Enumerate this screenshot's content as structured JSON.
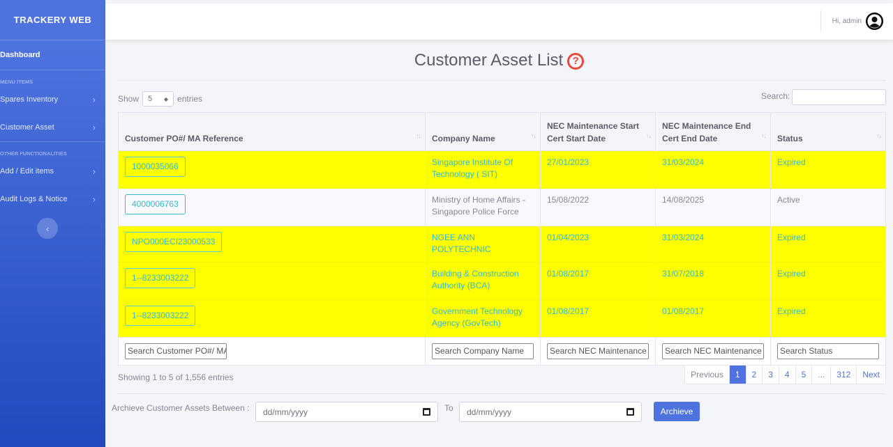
{
  "sidebar": {
    "brand": "TRACKERY WEB",
    "dashboard": "Dashboard",
    "heading_menu": "MENU ITEMS",
    "heading_other": "OTHER FUNCTIONALITIES",
    "items": [
      {
        "label": "Spares Inventory"
      },
      {
        "label": "Customer Asset"
      },
      {
        "label": "Add / Edit items"
      },
      {
        "label": "Audit Logs & Notice"
      }
    ]
  },
  "topbar": {
    "greeting": "Hi, admin"
  },
  "page": {
    "title": "Customer Asset List",
    "help": "?"
  },
  "controls": {
    "show_label": "Show",
    "entries_value": "5",
    "entries_label": "entries",
    "search_label": "Search:"
  },
  "table": {
    "columns": [
      {
        "label": "Customer PO#/ MA Reference"
      },
      {
        "label": "Company Name"
      },
      {
        "label": "NEC Maintenance Start Cert Start Date"
      },
      {
        "label": "NEC Maintenance End Cert End Date"
      },
      {
        "label": "Status"
      }
    ],
    "rows": [
      {
        "ref": "1000035066",
        "company": "Singapore Institute Of Technology ( SIT)",
        "start": "27/01/2023",
        "end": "31/03/2024",
        "status": "Expired"
      },
      {
        "ref": "4000006763",
        "company": "Ministry of Home Affairs - Singapore Police Force",
        "start": "15/08/2022",
        "end": "14/08/2025",
        "status": "Active"
      },
      {
        "ref": "NPO000ECI23000533",
        "company": "NGEE ANN POLYTECHNIC",
        "start": "01/04/2023",
        "end": "31/03/2024",
        "status": "Expired"
      },
      {
        "ref": "1--8233003222",
        "company": "Building & Construction Authority (BCA)",
        "start": "01/08/2017",
        "end": "31/07/2018",
        "status": "Expired"
      },
      {
        "ref": "1--8233003222",
        "company": "Government Technology Agency (GovTech)",
        "start": "01/08/2017",
        "end": "01/08/2017",
        "status": "Expired"
      }
    ],
    "footer_placeholders": [
      "Search Customer PO#/ MA",
      "Search Company Name",
      "Search NEC Maintenance S",
      "Search NEC Maintenance E",
      "Search Status"
    ]
  },
  "info": "Showing 1 to 5 of 1,556 entries",
  "pagination": {
    "previous": "Previous",
    "pages": [
      "1",
      "2",
      "3",
      "4",
      "5"
    ],
    "ellipsis": "...",
    "last": "312",
    "next": "Next",
    "current": "1"
  },
  "archive": {
    "label": "Archieve Customer Assets Between :",
    "from_placeholder": "dd/mm/yyyy",
    "to_label": "To",
    "to_placeholder": "dd/mm/yyyy",
    "button": "Archieve"
  }
}
